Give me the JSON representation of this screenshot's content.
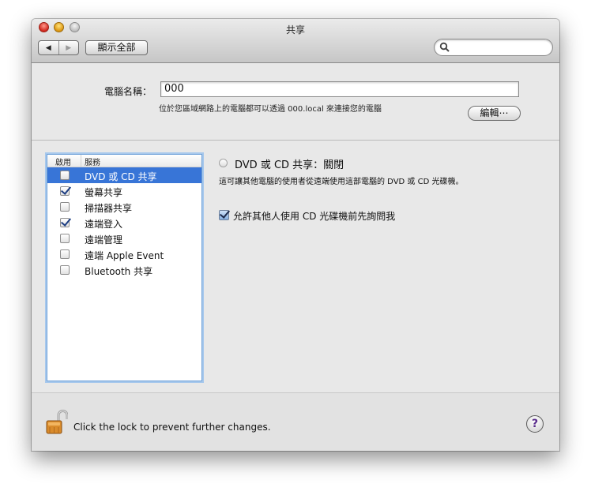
{
  "window": {
    "title": "共享"
  },
  "toolbar": {
    "back_glyph": "◀",
    "forward_glyph": "▶",
    "show_all_label": "顯示全部",
    "search_placeholder": ""
  },
  "computer_name": {
    "label": "電腦名稱：",
    "value": "000",
    "description": "位於您區域網路上的電腦都可以透過 000.local 來連接您的電腦",
    "edit_label": "編輯⋯"
  },
  "services": {
    "header_on": "啟用",
    "header_service": "服務",
    "items": [
      {
        "label": "DVD 或 CD 共享",
        "checked": false,
        "selected": true
      },
      {
        "label": "螢幕共享",
        "checked": true,
        "selected": false
      },
      {
        "label": "掃描器共享",
        "checked": false,
        "selected": false
      },
      {
        "label": "遠端登入",
        "checked": true,
        "selected": false
      },
      {
        "label": "遠端管理",
        "checked": false,
        "selected": false
      },
      {
        "label": "遠端 Apple Event",
        "checked": false,
        "selected": false
      },
      {
        "label": "Bluetooth 共享",
        "checked": false,
        "selected": false
      }
    ]
  },
  "detail": {
    "status": "DVD 或 CD 共享：關閉",
    "description": "這可讓其他電腦的使用者從遠端使用這部電腦的 DVD 或 CD 光碟機。",
    "ask_label": "允許其他人使用 CD 光碟機前先詢問我",
    "ask_checked": true
  },
  "footer": {
    "lock_text": "Click the lock to prevent further changes.",
    "help_label": "?"
  },
  "colors": {
    "selection": "#3875d7",
    "window_bg": "#e8e8e8",
    "focus_ring": "#6fa1d8"
  }
}
